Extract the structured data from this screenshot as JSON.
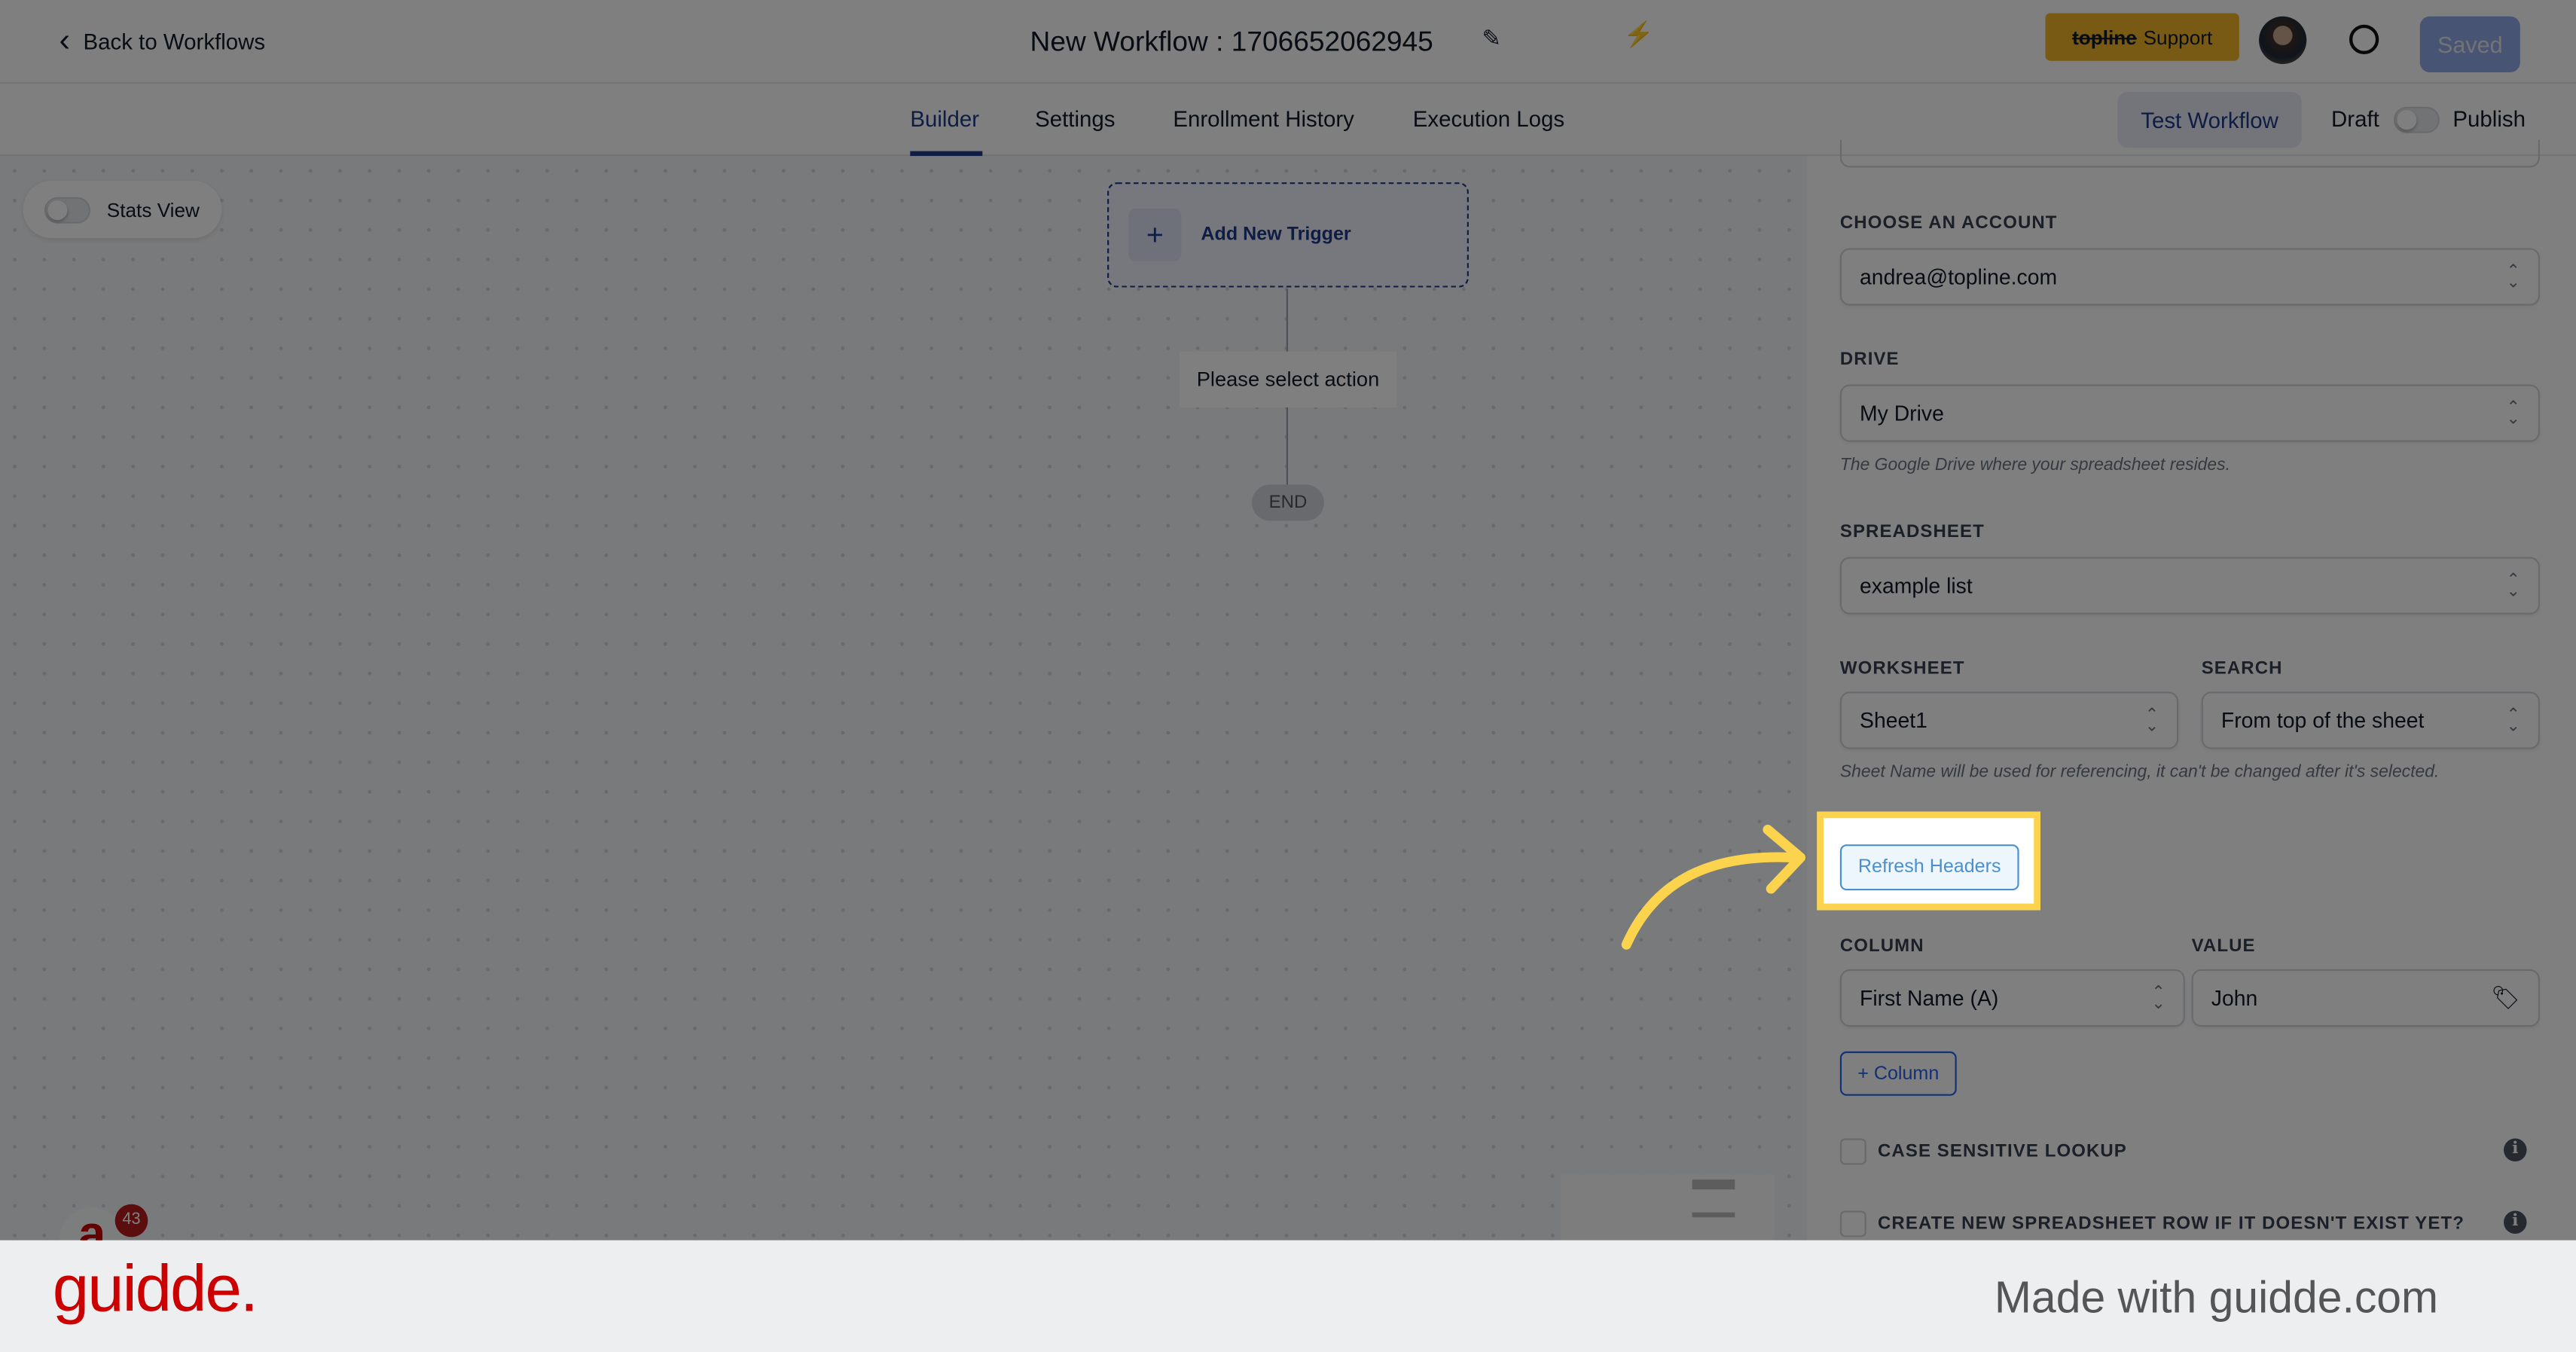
{
  "header": {
    "back_label": "Back to Workflows",
    "title": "New Workflow : 1706652062945",
    "support_brand": "topline",
    "support_label": "Support",
    "saved_label": "Saved"
  },
  "tabs": [
    {
      "label": "Builder",
      "active": true
    },
    {
      "label": "Settings"
    },
    {
      "label": "Enrollment History"
    },
    {
      "label": "Execution Logs"
    }
  ],
  "actions": {
    "test_workflow": "Test Workflow",
    "draft": "Draft",
    "publish": "Publish"
  },
  "canvas": {
    "stats_view": "Stats View",
    "add_trigger": "Add New Trigger",
    "select_action": "Please select action",
    "end": "END",
    "notification_count": "43"
  },
  "panel": {
    "account_label": "CHOOSE AN ACCOUNT",
    "account_value": "andrea@topline.com",
    "drive_label": "DRIVE",
    "drive_value": "My Drive",
    "drive_hint": "The Google Drive where your spreadsheet resides.",
    "spreadsheet_label": "SPREADSHEET",
    "spreadsheet_value": "example list",
    "worksheet_label": "WORKSHEET",
    "worksheet_value": "Sheet1",
    "search_label": "SEARCH",
    "search_value": "From top of the sheet",
    "worksheet_hint": "Sheet Name will be used for referencing, it can't be changed after it's selected.",
    "refresh_headers": "Refresh Headers",
    "column_label": "COLUMN",
    "column_value": "First Name (A)",
    "value_label": "VALUE",
    "value_value": "John",
    "add_column": "+ Column",
    "case_sensitive": "CASE SENSITIVE LOOKUP",
    "create_row": "CREATE NEW SPREADSHEET ROW IF IT DOESN'T EXIST YET?"
  },
  "footer": {
    "logo": "guidde.",
    "tagline": "Made with guidde.com"
  },
  "colors": {
    "accent": "#1e3a8a",
    "highlight": "#fcd34d",
    "brand_red": "#cc0000",
    "support": "#f0b429",
    "saved": "#8fa8e6"
  }
}
